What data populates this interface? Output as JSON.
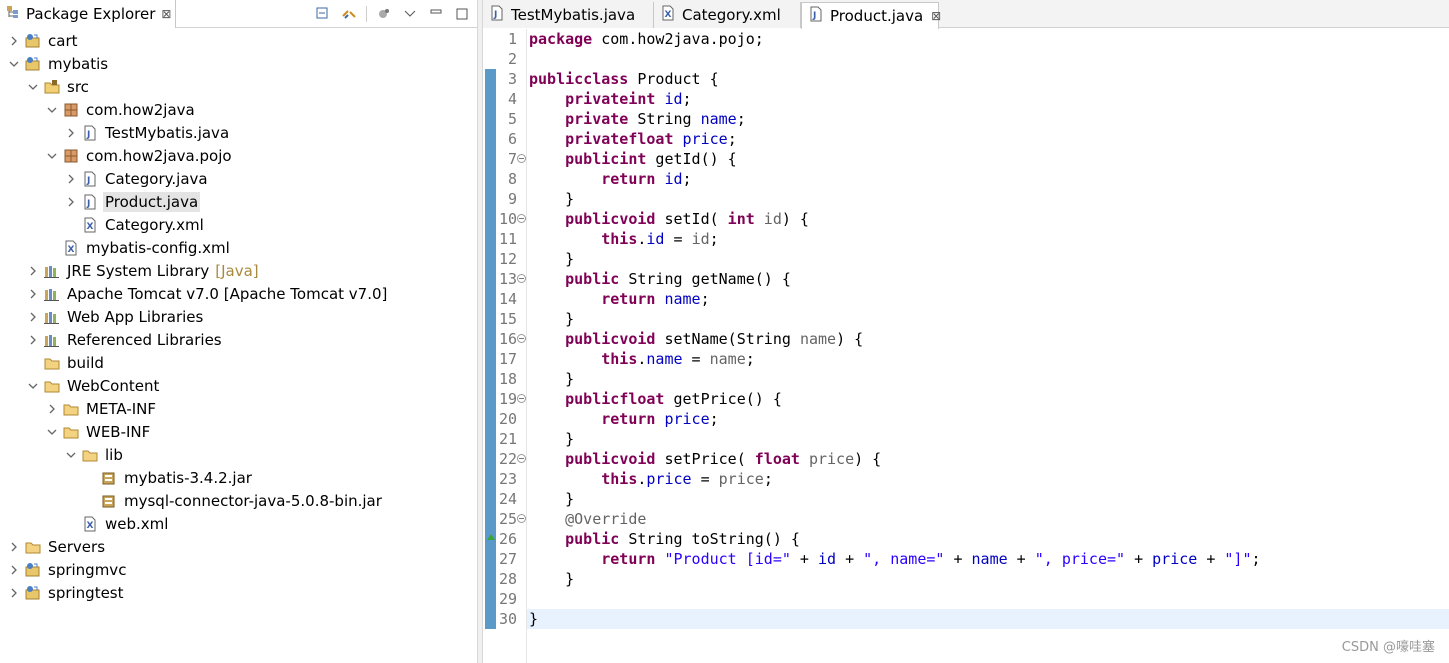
{
  "explorer": {
    "title": "Package Explorer",
    "close_glyph": "⊠",
    "tree": [
      {
        "label": "cart",
        "arrow": "›",
        "icon": "project-icon",
        "depth": 0
      },
      {
        "label": "mybatis",
        "arrow": "⌄",
        "icon": "project-icon",
        "depth": 0
      },
      {
        "label": "src",
        "arrow": "⌄",
        "icon": "source-folder-icon",
        "depth": 1
      },
      {
        "label": "com.how2java",
        "arrow": "⌄",
        "icon": "package-icon",
        "depth": 2
      },
      {
        "label": "TestMybatis.java",
        "arrow": "›",
        "icon": "java-file-icon",
        "depth": 3
      },
      {
        "label": "com.how2java.pojo",
        "arrow": "⌄",
        "icon": "package-icon",
        "depth": 2
      },
      {
        "label": "Category.java",
        "arrow": "›",
        "icon": "java-file-icon",
        "depth": 3
      },
      {
        "label": "Product.java",
        "arrow": "›",
        "icon": "java-file-icon",
        "depth": 3,
        "selected": true
      },
      {
        "label": "Category.xml",
        "arrow": "",
        "icon": "xml-file-icon",
        "depth": 3
      },
      {
        "label": "mybatis-config.xml",
        "arrow": "",
        "icon": "xml-file-icon",
        "depth": 2
      },
      {
        "label": "JRE System Library",
        "decoration": "[Java]",
        "arrow": "›",
        "icon": "library-icon",
        "depth": 1
      },
      {
        "label": "Apache Tomcat v7.0 [Apache Tomcat v7.0]",
        "arrow": "›",
        "icon": "library-icon",
        "depth": 1
      },
      {
        "label": "Web App Libraries",
        "arrow": "›",
        "icon": "library-icon",
        "depth": 1
      },
      {
        "label": "Referenced Libraries",
        "arrow": "›",
        "icon": "library-icon",
        "depth": 1
      },
      {
        "label": "build",
        "arrow": "",
        "icon": "folder-icon",
        "depth": 1
      },
      {
        "label": "WebContent",
        "arrow": "⌄",
        "icon": "folder-icon",
        "depth": 1
      },
      {
        "label": "META-INF",
        "arrow": "›",
        "icon": "folder-icon",
        "depth": 2
      },
      {
        "label": "WEB-INF",
        "arrow": "⌄",
        "icon": "folder-icon",
        "depth": 2
      },
      {
        "label": "lib",
        "arrow": "⌄",
        "icon": "folder-icon",
        "depth": 3
      },
      {
        "label": "mybatis-3.4.2.jar",
        "arrow": "",
        "icon": "jar-icon",
        "depth": 4
      },
      {
        "label": "mysql-connector-java-5.0.8-bin.jar",
        "arrow": "",
        "icon": "jar-icon",
        "depth": 4
      },
      {
        "label": "web.xml",
        "arrow": "",
        "icon": "xml-file-icon",
        "depth": 3
      },
      {
        "label": "Servers",
        "arrow": "›",
        "icon": "folder-icon",
        "depth": 0
      },
      {
        "label": "springmvc",
        "arrow": "›",
        "icon": "project-icon",
        "depth": 0
      },
      {
        "label": "springtest",
        "arrow": "›",
        "icon": "project-icon",
        "depth": 0
      }
    ]
  },
  "editor": {
    "tabs": [
      {
        "label": "TestMybatis.java",
        "icon": "java-file-icon",
        "active": false
      },
      {
        "label": "Category.xml",
        "icon": "xml-file-icon",
        "active": false
      },
      {
        "label": "Product.java",
        "icon": "java-file-icon",
        "active": true,
        "close": "⊠"
      }
    ],
    "lines": [
      [
        [
          "k",
          "package"
        ],
        [
          "",
          "com.how2java.pojo;"
        ]
      ],
      [],
      [
        [
          "k",
          "public"
        ],
        [
          "",
          ""
        ],
        [
          "k",
          "class"
        ],
        [
          "",
          "Product {"
        ]
      ],
      [
        [
          "",
          "    "
        ],
        [
          "k",
          "private"
        ],
        [
          "",
          ""
        ],
        [
          "k",
          "int"
        ],
        [
          "f",
          "id"
        ],
        [
          "",
          ";"
        ]
      ],
      [
        [
          "",
          "    "
        ],
        [
          "k",
          "private"
        ],
        [
          "",
          "String"
        ],
        [
          "f",
          "name"
        ],
        [
          "",
          ";"
        ]
      ],
      [
        [
          "",
          "    "
        ],
        [
          "k",
          "private"
        ],
        [
          "",
          ""
        ],
        [
          "k",
          "float"
        ],
        [
          "f",
          "price"
        ],
        [
          "",
          ";"
        ]
      ],
      [
        [
          "",
          "    "
        ],
        [
          "k",
          "public"
        ],
        [
          "",
          ""
        ],
        [
          "k",
          "int"
        ],
        [
          "",
          "getId() {"
        ]
      ],
      [
        [
          "",
          "        "
        ],
        [
          "k",
          "return"
        ],
        [
          "f",
          "id"
        ],
        [
          "",
          ";"
        ]
      ],
      [
        [
          "",
          "    }"
        ]
      ],
      [
        [
          "",
          "    "
        ],
        [
          "k",
          "public"
        ],
        [
          "",
          ""
        ],
        [
          "k",
          "void"
        ],
        [
          "",
          "setId("
        ],
        [
          "k",
          "int"
        ],
        [
          "a",
          "id"
        ],
        [
          "",
          ") {"
        ]
      ],
      [
        [
          "",
          "        "
        ],
        [
          "k",
          "this"
        ],
        [
          "",
          "."
        ],
        [
          "f",
          "id"
        ],
        [
          "",
          "= "
        ],
        [
          "a",
          "id"
        ],
        [
          "",
          ";"
        ]
      ],
      [
        [
          "",
          "    }"
        ]
      ],
      [
        [
          "",
          "    "
        ],
        [
          "k",
          "public"
        ],
        [
          "",
          "String getName() {"
        ]
      ],
      [
        [
          "",
          "        "
        ],
        [
          "k",
          "return"
        ],
        [
          "f",
          "name"
        ],
        [
          "",
          ";"
        ]
      ],
      [
        [
          "",
          "    }"
        ]
      ],
      [
        [
          "",
          "    "
        ],
        [
          "k",
          "public"
        ],
        [
          "",
          ""
        ],
        [
          "k",
          "void"
        ],
        [
          "",
          "setName(String "
        ],
        [
          "a",
          "name"
        ],
        [
          "",
          ") {"
        ]
      ],
      [
        [
          "",
          "        "
        ],
        [
          "k",
          "this"
        ],
        [
          "",
          "."
        ],
        [
          "f",
          "name"
        ],
        [
          "",
          "= "
        ],
        [
          "a",
          "name"
        ],
        [
          "",
          ";"
        ]
      ],
      [
        [
          "",
          "    }"
        ]
      ],
      [
        [
          "",
          "    "
        ],
        [
          "k",
          "public"
        ],
        [
          "",
          ""
        ],
        [
          "k",
          "float"
        ],
        [
          "",
          "getPrice() {"
        ]
      ],
      [
        [
          "",
          "        "
        ],
        [
          "k",
          "return"
        ],
        [
          "f",
          "price"
        ],
        [
          "",
          ";"
        ]
      ],
      [
        [
          "",
          "    }"
        ]
      ],
      [
        [
          "",
          "    "
        ],
        [
          "k",
          "public"
        ],
        [
          "",
          ""
        ],
        [
          "k",
          "void"
        ],
        [
          "",
          "setPrice("
        ],
        [
          "k",
          "float"
        ],
        [
          "a",
          "price"
        ],
        [
          "",
          ") {"
        ]
      ],
      [
        [
          "",
          "        "
        ],
        [
          "k",
          "this"
        ],
        [
          "",
          "."
        ],
        [
          "f",
          "price"
        ],
        [
          "",
          "= "
        ],
        [
          "a",
          "price"
        ],
        [
          "",
          ";"
        ]
      ],
      [
        [
          "",
          "    }"
        ]
      ],
      [
        [
          "",
          "    "
        ],
        [
          "a",
          "@Override"
        ]
      ],
      [
        [
          "",
          "    "
        ],
        [
          "k",
          "public"
        ],
        [
          "",
          "String toString() {"
        ]
      ],
      [
        [
          "",
          "        "
        ],
        [
          "k",
          "return"
        ],
        [
          "s",
          "\"Product [id=\""
        ],
        [
          "",
          "+ "
        ],
        [
          "f",
          "id"
        ],
        [
          "",
          "+ "
        ],
        [
          "s",
          "\", name=\""
        ],
        [
          "",
          "+ "
        ],
        [
          "f",
          "name"
        ],
        [
          "",
          "+ "
        ],
        [
          "s",
          "\", price=\""
        ],
        [
          "",
          "+ "
        ],
        [
          "f",
          "price"
        ],
        [
          "",
          "+ "
        ],
        [
          "s",
          "\"]\""
        ],
        [
          "",
          ";"
        ]
      ],
      [
        [
          "",
          "    }"
        ]
      ],
      [],
      [
        [
          "",
          "}"
        ]
      ]
    ],
    "line_numbers": [
      "1",
      "2",
      "3",
      "4",
      "5",
      "6",
      "7",
      "8",
      "9",
      "10",
      "11",
      "12",
      "13",
      "14",
      "15",
      "16",
      "17",
      "18",
      "19",
      "20",
      "21",
      "22",
      "23",
      "24",
      "25",
      "26",
      "27",
      "28",
      "29",
      "30"
    ],
    "fold_lines": [
      7,
      10,
      13,
      16,
      19,
      22,
      25
    ],
    "override_line": 26
  },
  "watermark": "CSDN @嚎哇塞",
  "colors": {
    "keyword": "#7f0055",
    "field": "#0000c0",
    "string": "#2a00ff",
    "annotation": "#646464",
    "selection": "#e4e4e4",
    "current_line": "#e8f2fe"
  }
}
